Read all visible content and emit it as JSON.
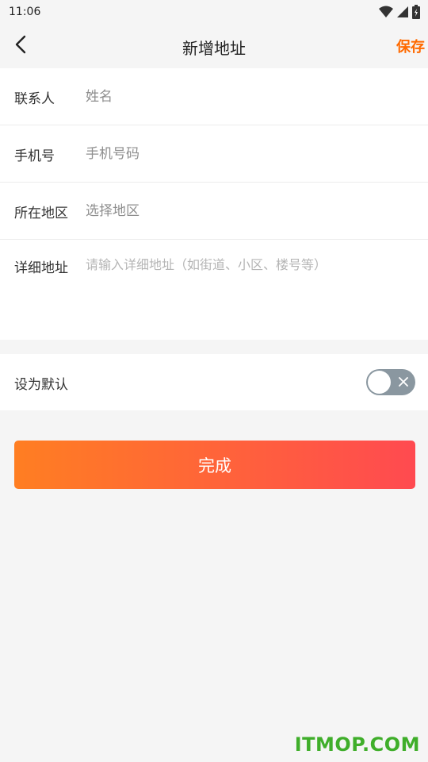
{
  "status_bar": {
    "time": "11:06",
    "icons": [
      "wifi-icon",
      "signal-icon",
      "battery-icon"
    ]
  },
  "header": {
    "back_icon": "chevron-left-icon",
    "title": "新增地址",
    "save_label": "保存"
  },
  "form": {
    "contact": {
      "label": "联系人",
      "placeholder": "姓名",
      "value": ""
    },
    "phone": {
      "label": "手机号",
      "placeholder": "手机号码",
      "value": ""
    },
    "region": {
      "label": "所在地区",
      "placeholder": "选择地区",
      "value": ""
    },
    "detail": {
      "label": "详细地址",
      "placeholder": "请输入详细地址（如街道、小区、楼号等）",
      "value": ""
    }
  },
  "default_setting": {
    "label": "设为默认",
    "enabled": false
  },
  "done_button": {
    "label": "完成"
  },
  "watermark": {
    "text": "ITMOP.COM"
  },
  "colors": {
    "accent": "#ff6a00",
    "button_gradient_start": "#ff7e22",
    "button_gradient_end": "#ff4a50",
    "toggle_off": "#8a97a0",
    "background": "#f5f5f5",
    "watermark": "#3fae2a"
  }
}
